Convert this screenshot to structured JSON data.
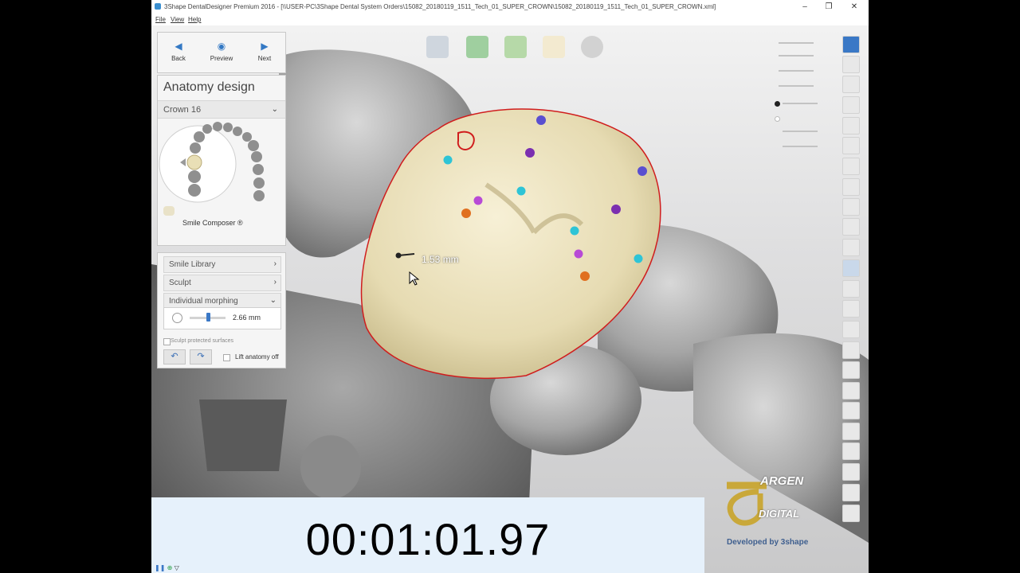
{
  "window": {
    "title": "3Shape DentalDesigner Premium 2016 - [\\\\USER-PC\\3Shape Dental System Orders\\15082_20180119_1511_Tech_01_SUPER_CROWN\\15082_20180119_1511_Tech_01_SUPER_CROWN.xml]",
    "controls": {
      "minimize": "–",
      "restore": "❐",
      "close": "✕"
    }
  },
  "menu": {
    "file": "File",
    "view": "View",
    "help": "Help"
  },
  "nav": {
    "back": "Back",
    "preview": "Preview",
    "next": "Next",
    "back_icon": "◀",
    "preview_icon": "◉",
    "next_icon": "▶"
  },
  "anatomy": {
    "heading": "Anatomy design",
    "crown_label": "Crown 16",
    "smile_composer": "Smile Composer ®"
  },
  "tools": {
    "smile_library": "Smile Library",
    "sculpt": "Sculpt",
    "individual_morphing": "Individual morphing",
    "morph_value": "2.66 mm",
    "morph_level": 0.52,
    "sculpt_protected": "Sculpt protected surfaces",
    "lift_anatomy_off": "Lift anatomy off",
    "undo_icon": "↶",
    "redo_icon": "↷"
  },
  "viewport": {
    "measurement": "1.53 mm"
  },
  "timer": {
    "text": "00:01:01.97"
  },
  "logo": {
    "brand_top": "ARGEN",
    "brand_bottom": "DIGITAL",
    "developed_by": "Developed by 3shape"
  },
  "colors": {
    "crown": "#efe6c4",
    "margin_line": "#d01d1d",
    "accent": "#3479c4",
    "logo_gold": "#c9a83a",
    "timer_bg": "#e6f1fb"
  }
}
